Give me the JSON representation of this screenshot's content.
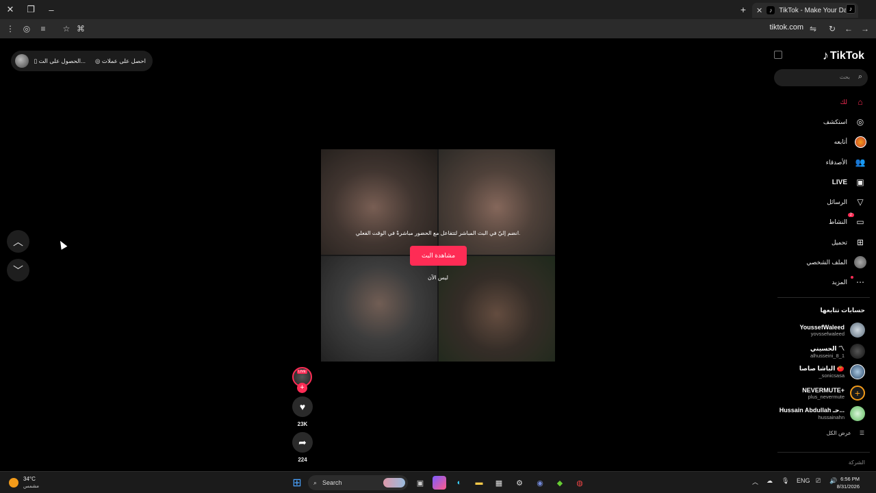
{
  "browser": {
    "tab_title": "TikTok - Make Your Day",
    "new_tab_icon": "+",
    "url": "tiktok.com"
  },
  "top_pill": {
    "get_app": "الحصول على الت...",
    "get_coins": "احصل على عملات"
  },
  "video": {
    "live_message": "انضم إليّ في البث المباشر لتتفاعل مع الحضور مباشرةً في الوقت الفعلي.",
    "watch_button": "مشاهدة البث",
    "not_now": "ليس الآن",
    "live_tag": "LIVE"
  },
  "actions": {
    "likes": "23K",
    "shares": "224"
  },
  "sidebar": {
    "logo": "TikTok",
    "search_placeholder": "بحث",
    "nav": [
      {
        "label": "لك",
        "icon": "home-icon"
      },
      {
        "label": "استكشف",
        "icon": "compass-icon"
      },
      {
        "label": "أتابعه",
        "icon": "following-icon"
      },
      {
        "label": "الأصدقاء",
        "icon": "friends-icon"
      },
      {
        "label": "LIVE",
        "icon": "live-tv-icon"
      },
      {
        "label": "الرسائل",
        "icon": "send-icon"
      },
      {
        "label": "النشاط",
        "icon": "activity-icon",
        "badge": "2"
      },
      {
        "label": "تحميل",
        "icon": "upload-icon"
      },
      {
        "label": "الملف الشخصي",
        "icon": "profile-avatar-icon"
      },
      {
        "label": "المزيد",
        "icon": "more-icon"
      }
    ],
    "following_title": "حسابات تتابعها",
    "accounts": [
      {
        "name": "YoussefWaleed",
        "handle": "yovssefwaleed",
        "color": "#8ea3b8"
      },
      {
        "name": "الحسيني 〽",
        "handle": "alhusseini_8_1",
        "color": "#333"
      },
      {
        "name": "الباشا صاصا 🍅",
        "handle": "_sonicsasa",
        "color": "#6a8fb0"
      },
      {
        "name": "NEVERMUTE+",
        "handle": "plus_nevermute",
        "color": "#f39b1a"
      },
      {
        "name": "Hussain Abdullah حـ...",
        "handle": "hussainahn",
        "color": "#7fd07f"
      }
    ],
    "see_all": "عرض الكل",
    "company": "الشركة"
  },
  "taskbar": {
    "temperature": "34°C",
    "weather": "مشمس",
    "search": "Search",
    "lang": "ENG",
    "time": "6:56 PM",
    "date": "8/31/2026"
  }
}
